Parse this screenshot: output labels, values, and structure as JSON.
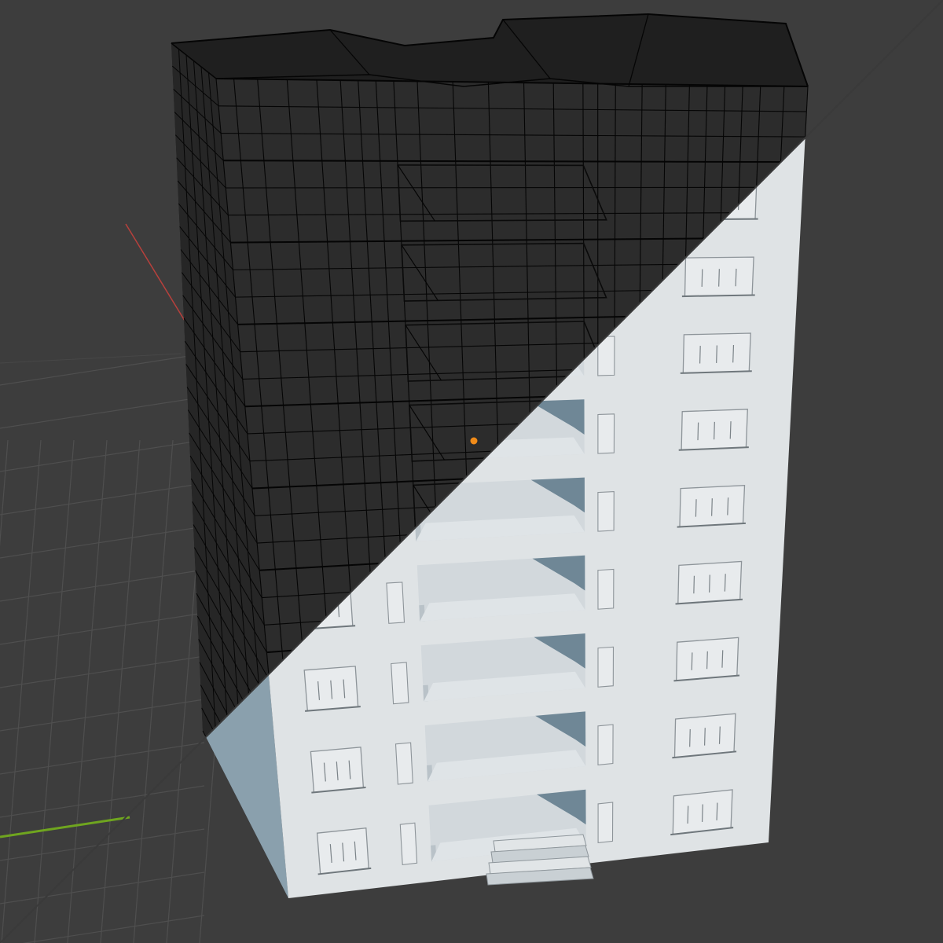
{
  "viewport": {
    "mode_left": "wireframe",
    "mode_right": "solid",
    "background": "#3d3d3d",
    "grid_color": "#4f4f4f",
    "axis_x_color": "#b8403c",
    "axis_y_color": "#6fa51f",
    "origin_color": "#f08b19"
  },
  "building": {
    "floors": 10,
    "recessed_balcony_floors": 8,
    "window_columns_left": 1,
    "window_columns_right": 1,
    "wall_color": "#dfe3e5",
    "side_color": "#8aa0ad",
    "shadow_color": "#6f8796",
    "wire_fill": "#1f1f1f",
    "wire_line": "#050505"
  },
  "icons": {
    "origin": "object-origin-icon",
    "divider": "split-view-divider"
  }
}
